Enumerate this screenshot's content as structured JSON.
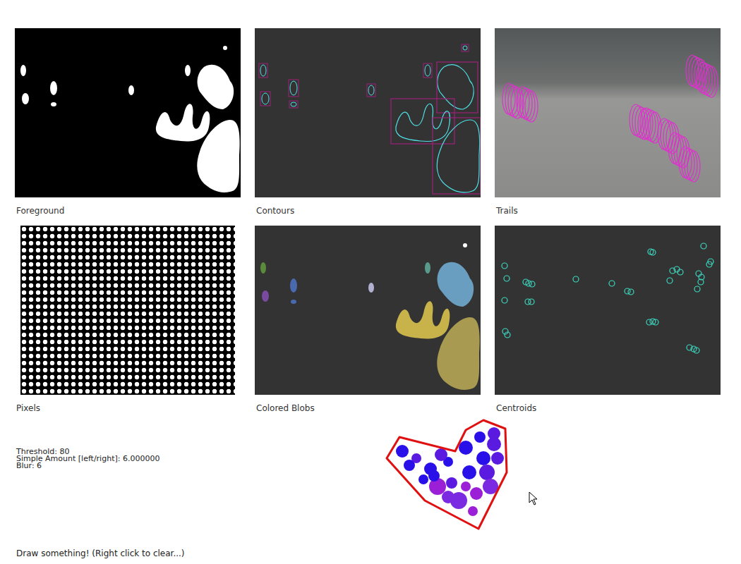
{
  "panels": [
    {
      "label": "Foreground",
      "kind": "mask"
    },
    {
      "label": "Contours",
      "kind": "contours"
    },
    {
      "label": "Trails",
      "kind": "photo"
    },
    {
      "label": "Pixels",
      "kind": "dots"
    },
    {
      "label": "Colored Blobs",
      "kind": "blobs"
    },
    {
      "label": "Centroids",
      "kind": "centroids"
    }
  ],
  "settings": [
    "Threshold: 80",
    "Simple Amount [left/right]: 6.000000",
    "Blur: 6"
  ],
  "hint": "Draw something! (Right click to clear...)"
}
